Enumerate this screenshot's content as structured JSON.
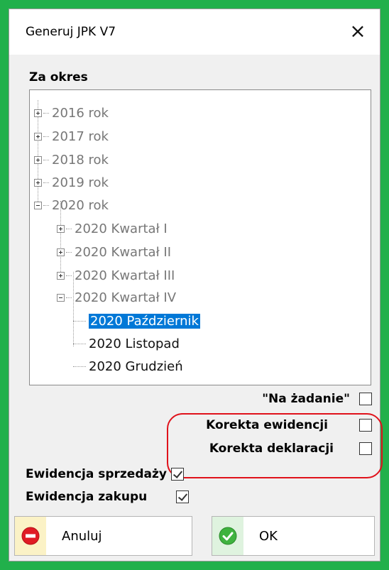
{
  "window": {
    "title": "Generuj JPK  V7",
    "close_symbol": "×"
  },
  "period_section": {
    "label": "Za okres"
  },
  "tree": {
    "years": [
      "2016 rok",
      "2017 rok",
      "2018 rok",
      "2019 rok",
      "2020 rok"
    ],
    "quarters": [
      "2020 Kwartał I",
      "2020 Kwartał II",
      "2020 Kwartał III",
      "2020 Kwartał IV"
    ],
    "months": [
      "2020 Październik",
      "2020 Listopad",
      "2020 Grudzień"
    ],
    "selected": "2020 Październik"
  },
  "options": {
    "na_zadanie": {
      "label": "\"Na żadanie\"",
      "checked": false
    },
    "korekta_ewidencji": {
      "label": "Korekta ewidencji",
      "checked": false
    },
    "korekta_deklaracji": {
      "label": "Korekta deklaracji",
      "checked": false
    },
    "ewidencja_sprzedazy": {
      "label": "Ewidencja sprzedaży",
      "checked": true
    },
    "ewidencja_zakupu": {
      "label": "Ewidencja zakupu",
      "checked": true
    }
  },
  "buttons": {
    "cancel": {
      "label": "Anuluj",
      "icon": "no-entry-icon",
      "color": "#e01b24"
    },
    "ok": {
      "label": "OK",
      "icon": "check-circle-icon",
      "color": "#3fb33f"
    }
  },
  "colors": {
    "frame": "#21b04b",
    "selection": "#0078d7",
    "highlight_oval": "#e0121b"
  }
}
